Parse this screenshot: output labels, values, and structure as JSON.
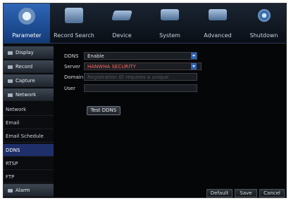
{
  "top_tabs": [
    {
      "label": "Parameter",
      "icon": "gear-icon",
      "active": true
    },
    {
      "label": "Record Search",
      "icon": "record-search-icon",
      "active": false
    },
    {
      "label": "Device",
      "icon": "device-icon",
      "active": false
    },
    {
      "label": "System",
      "icon": "system-icon",
      "active": false
    },
    {
      "label": "Advanced",
      "icon": "advanced-icon",
      "active": false
    },
    {
      "label": "Shutdown",
      "icon": "power-icon",
      "active": false
    }
  ],
  "sidebar": {
    "items": [
      {
        "label": "Display",
        "type": "group"
      },
      {
        "label": "Record",
        "type": "group"
      },
      {
        "label": "Capture",
        "type": "group"
      },
      {
        "label": "Network",
        "type": "group"
      },
      {
        "label": "Network",
        "type": "item"
      },
      {
        "label": "Email",
        "type": "item"
      },
      {
        "label": "Email Schedule",
        "type": "item"
      },
      {
        "label": "DDNS",
        "type": "item",
        "active": true
      },
      {
        "label": "RTSP",
        "type": "item"
      },
      {
        "label": "FTP",
        "type": "item"
      },
      {
        "label": "Alarm",
        "type": "group"
      }
    ]
  },
  "form": {
    "ddns_label": "DDNS",
    "ddns_value": "Enable",
    "server_label": "Server",
    "server_value": "HANWHA SECURITY",
    "domain_label": "Domain",
    "domain_placeholder": "Registration ID requires a unique",
    "user_label": "User",
    "user_value": "",
    "test_button": "Test DDNS"
  },
  "footer": {
    "default_label": "Default",
    "save_label": "Save",
    "cancel_label": "Cancel"
  },
  "colors": {
    "active_tab": "#2f67b8",
    "active_sidebar": "#1f2f6a",
    "dropdown_button": "#2b63b8",
    "server_highlight": "#b8201e"
  }
}
